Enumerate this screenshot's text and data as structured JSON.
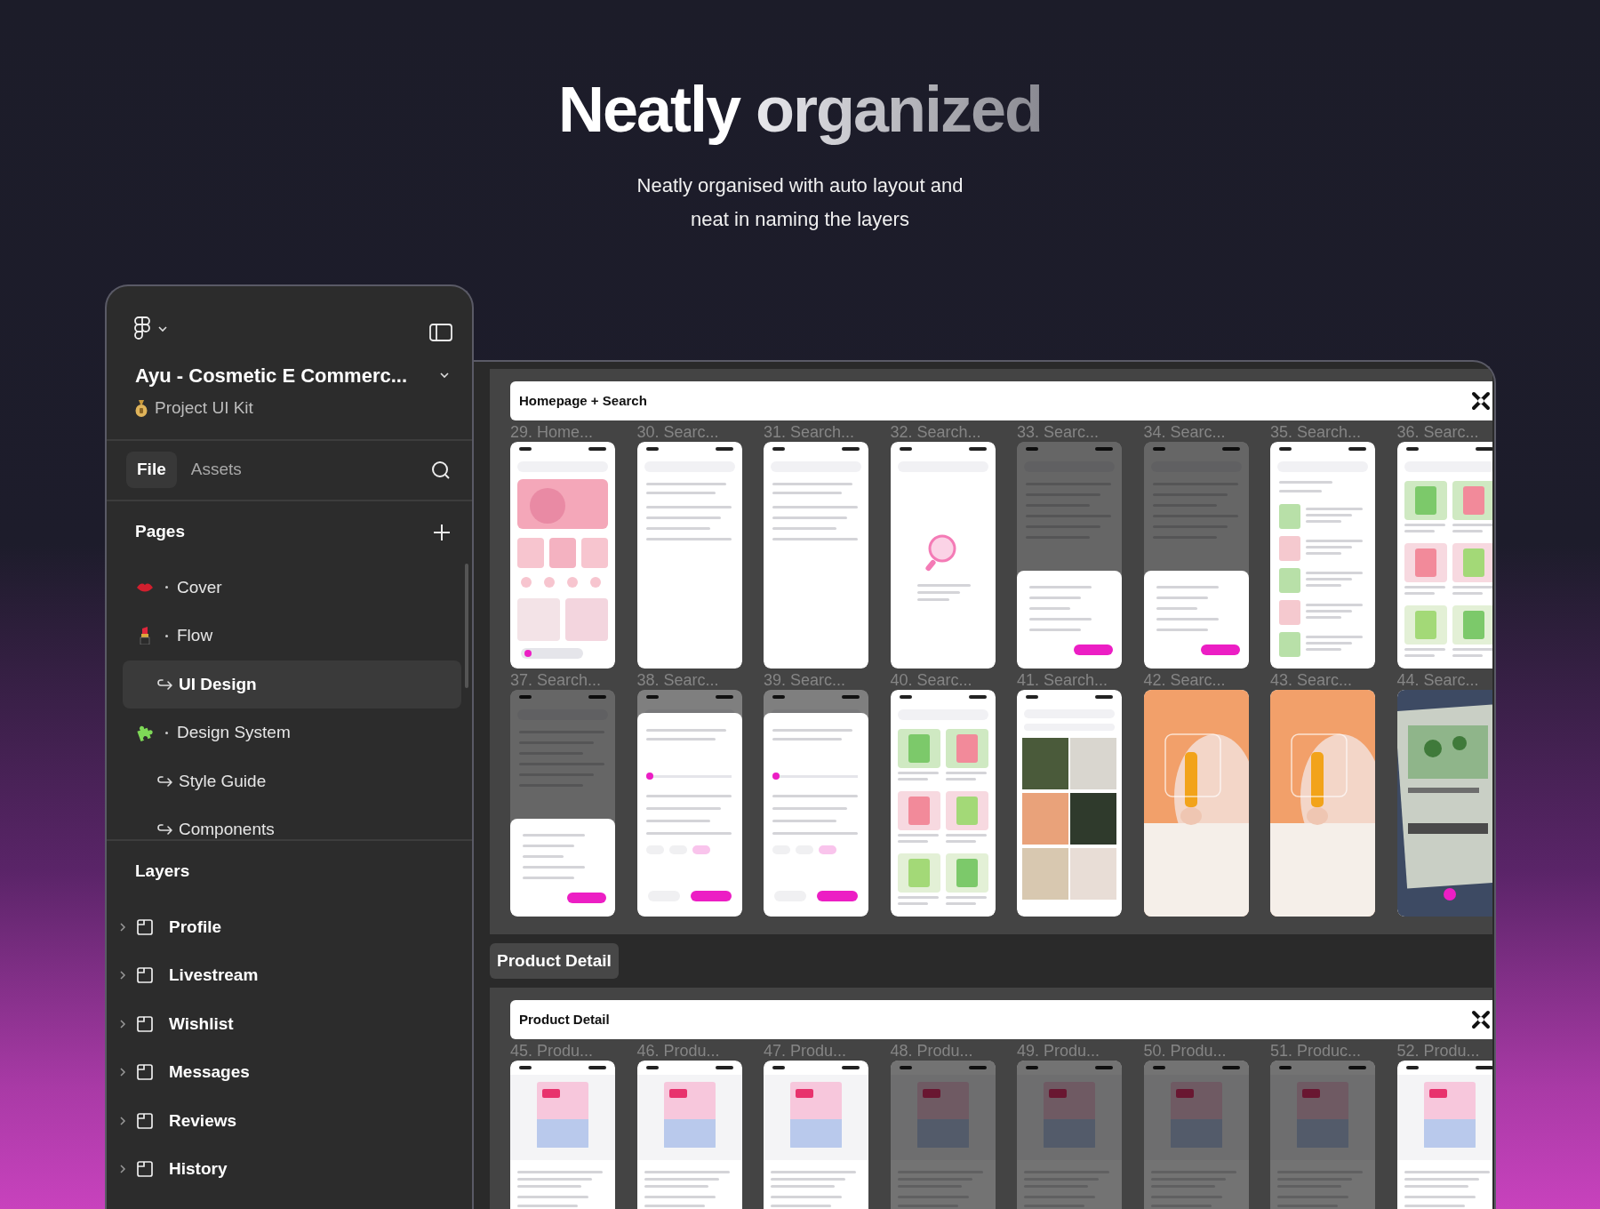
{
  "headline": {
    "lead": "Neatly",
    "accent": "organized"
  },
  "subtitle": "Neatly organised with auto layout and neat in naming the layers",
  "sidebar": {
    "file_title": "Ayu - Cosmetic E Commerc...",
    "project": "Project UI Kit",
    "tabs": [
      {
        "label": "File",
        "selected": true
      },
      {
        "label": "Assets",
        "selected": false
      }
    ],
    "pages_heading": "Pages",
    "pages": [
      {
        "label": "Cover",
        "kind": "lips",
        "selected": false
      },
      {
        "label": "Flow",
        "kind": "lipstick",
        "selected": false,
        "children": [
          {
            "label": "UI Design",
            "selected": true
          }
        ]
      },
      {
        "label": "Design System",
        "kind": "puzzle",
        "selected": false,
        "children": [
          {
            "label": "Style Guide",
            "selected": false
          },
          {
            "label": "Components",
            "selected": false
          }
        ]
      }
    ],
    "layers_heading": "Layers",
    "layers": [
      {
        "label": "Profile",
        "expanded": false
      },
      {
        "label": "Livestream",
        "expanded": false
      },
      {
        "label": "Wishlist",
        "expanded": false
      },
      {
        "label": "Messages",
        "expanded": false
      },
      {
        "label": "Reviews",
        "expanded": false
      },
      {
        "label": "History",
        "expanded": false
      }
    ]
  },
  "canvas": {
    "sections": [
      {
        "title": "Homepage + Search",
        "frames": [
          {
            "label": "29. Home...",
            "kind": "home",
            "dimmed": false
          },
          {
            "label": "30. Searc...",
            "kind": "search",
            "dimmed": false
          },
          {
            "label": "31. Search...",
            "kind": "search",
            "dimmed": false
          },
          {
            "label": "32. Search...",
            "kind": "empty",
            "dimmed": false
          },
          {
            "label": "33. Searc...",
            "kind": "sheet",
            "dimmed": true
          },
          {
            "label": "34. Searc...",
            "kind": "sheet",
            "dimmed": true
          },
          {
            "label": "35. Search...",
            "kind": "list",
            "dimmed": false
          },
          {
            "label": "36. Searc...",
            "kind": "grid",
            "dimmed": false
          },
          {
            "label": "37. Search...",
            "kind": "sheet",
            "dimmed": true
          },
          {
            "label": "38. Searc...",
            "kind": "filter",
            "dimmed": true
          },
          {
            "label": "39. Searc...",
            "kind": "filter",
            "dimmed": true
          },
          {
            "label": "40. Searc...",
            "kind": "grid",
            "dimmed": false
          },
          {
            "label": "41. Search...",
            "kind": "gallery",
            "dimmed": false
          },
          {
            "label": "42. Searc...",
            "kind": "camera",
            "dimmed": false
          },
          {
            "label": "43. Searc...",
            "kind": "camera",
            "dimmed": false
          },
          {
            "label": "44. Searc...",
            "kind": "scan",
            "dimmed": false
          }
        ]
      },
      {
        "tag": "Product Detail",
        "title": "Product Detail",
        "frames": [
          {
            "label": "45. Produ...",
            "kind": "product",
            "dimmed": false
          },
          {
            "label": "46. Produ...",
            "kind": "product",
            "dimmed": false
          },
          {
            "label": "47. Produ...",
            "kind": "product",
            "dimmed": false
          },
          {
            "label": "48. Produ...",
            "kind": "product",
            "dimmed": true
          },
          {
            "label": "49. Produ...",
            "kind": "product",
            "dimmed": true
          },
          {
            "label": "50. Produ...",
            "kind": "product",
            "dimmed": true
          },
          {
            "label": "51. Produc...",
            "kind": "product",
            "dimmed": true
          },
          {
            "label": "52. Produ...",
            "kind": "product",
            "dimmed": false
          }
        ]
      }
    ]
  }
}
